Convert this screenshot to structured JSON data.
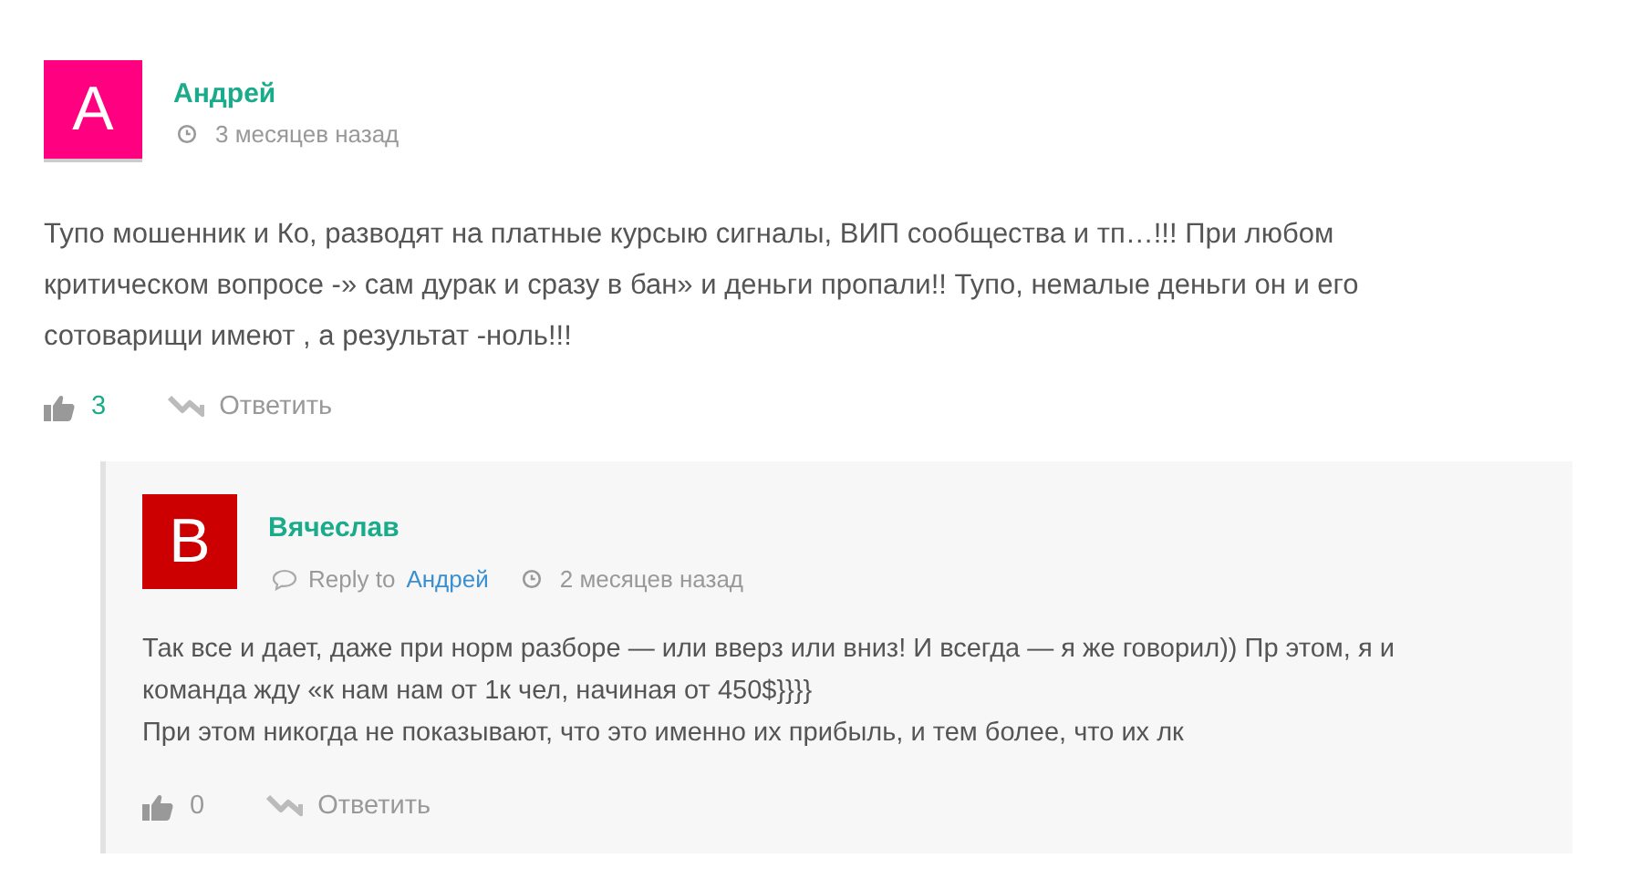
{
  "comments": [
    {
      "author": "Андрей",
      "initial": "A",
      "color": "#ff0080",
      "time": "3 месяцев назад",
      "paragraphs": [
        "Тупо мошенник и Ко, разводят на платные курсыю сигналы, ВИП сообщества и тп…!!! При любом критическом вопросе -» сам дурак и сразу в бан» и деньги пропали!! Тупо, немалые деньги он и его сотоварищи имеют , а результат -ноль!!!"
      ],
      "likes": "3",
      "reply_label": "Ответить",
      "replies": [
        {
          "author": "Вячеслав",
          "initial": "B",
          "color": "#cc0000",
          "reply_prefix": "Reply to",
          "reply_to": "Андрей",
          "time": "2 месяцев назад",
          "paragraphs": [
            "Так все и дает, даже при норм разборе — или вверз или вниз! И всегда — я же говорил)) Пр этом, я и команда жду «к нам нам от 1к чел, начиная от 450$}}}}",
            "При этом никогда не показывают, что это именно их прибыль, и тем более, что их лк"
          ],
          "likes": "0",
          "reply_label": "Ответить"
        }
      ]
    }
  ]
}
